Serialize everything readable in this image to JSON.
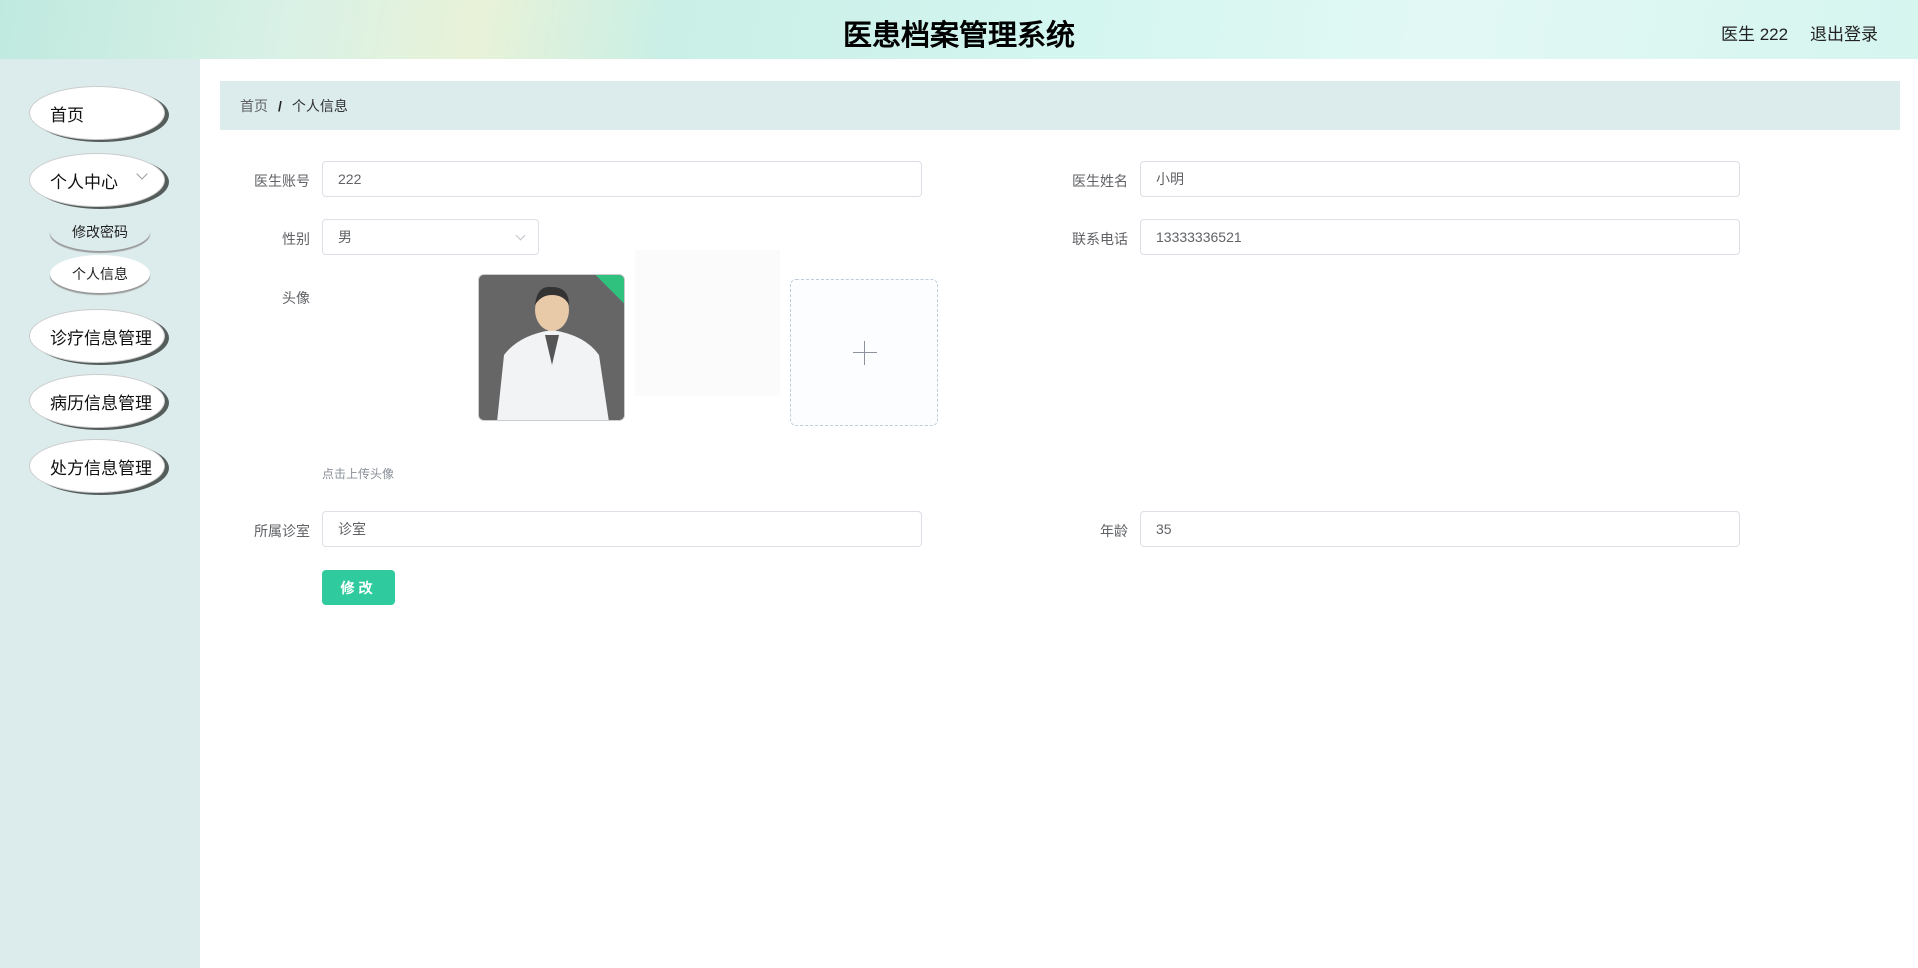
{
  "header": {
    "title": "医患档案管理系统",
    "user": "医生 222",
    "logout": "退出登录"
  },
  "sidebar": {
    "items": [
      {
        "label": "首页"
      },
      {
        "label": "个人中心",
        "children": [
          {
            "label": "修改密码"
          },
          {
            "label": "个人信息",
            "active": true
          }
        ]
      },
      {
        "label": "诊疗信息管理"
      },
      {
        "label": "病历信息管理"
      },
      {
        "label": "处方信息管理"
      }
    ]
  },
  "breadcrumb": {
    "home": "首页",
    "separator": "/",
    "current": "个人信息"
  },
  "form": {
    "account": {
      "label": "医生账号",
      "value": "222"
    },
    "name": {
      "label": "医生姓名",
      "value": "小明"
    },
    "gender": {
      "label": "性别",
      "value": "男"
    },
    "phone": {
      "label": "联系电话",
      "value": "13333336521"
    },
    "avatar": {
      "label": "头像",
      "hint": "点击上传头像"
    },
    "clinic": {
      "label": "所属诊室",
      "value": "诊室"
    },
    "age": {
      "label": "年龄",
      "value": "35"
    },
    "submit": "修改"
  },
  "colors": {
    "accent": "#2fcb9e",
    "sidebar_bg": "#dcecec",
    "success": "#2ec27e"
  }
}
